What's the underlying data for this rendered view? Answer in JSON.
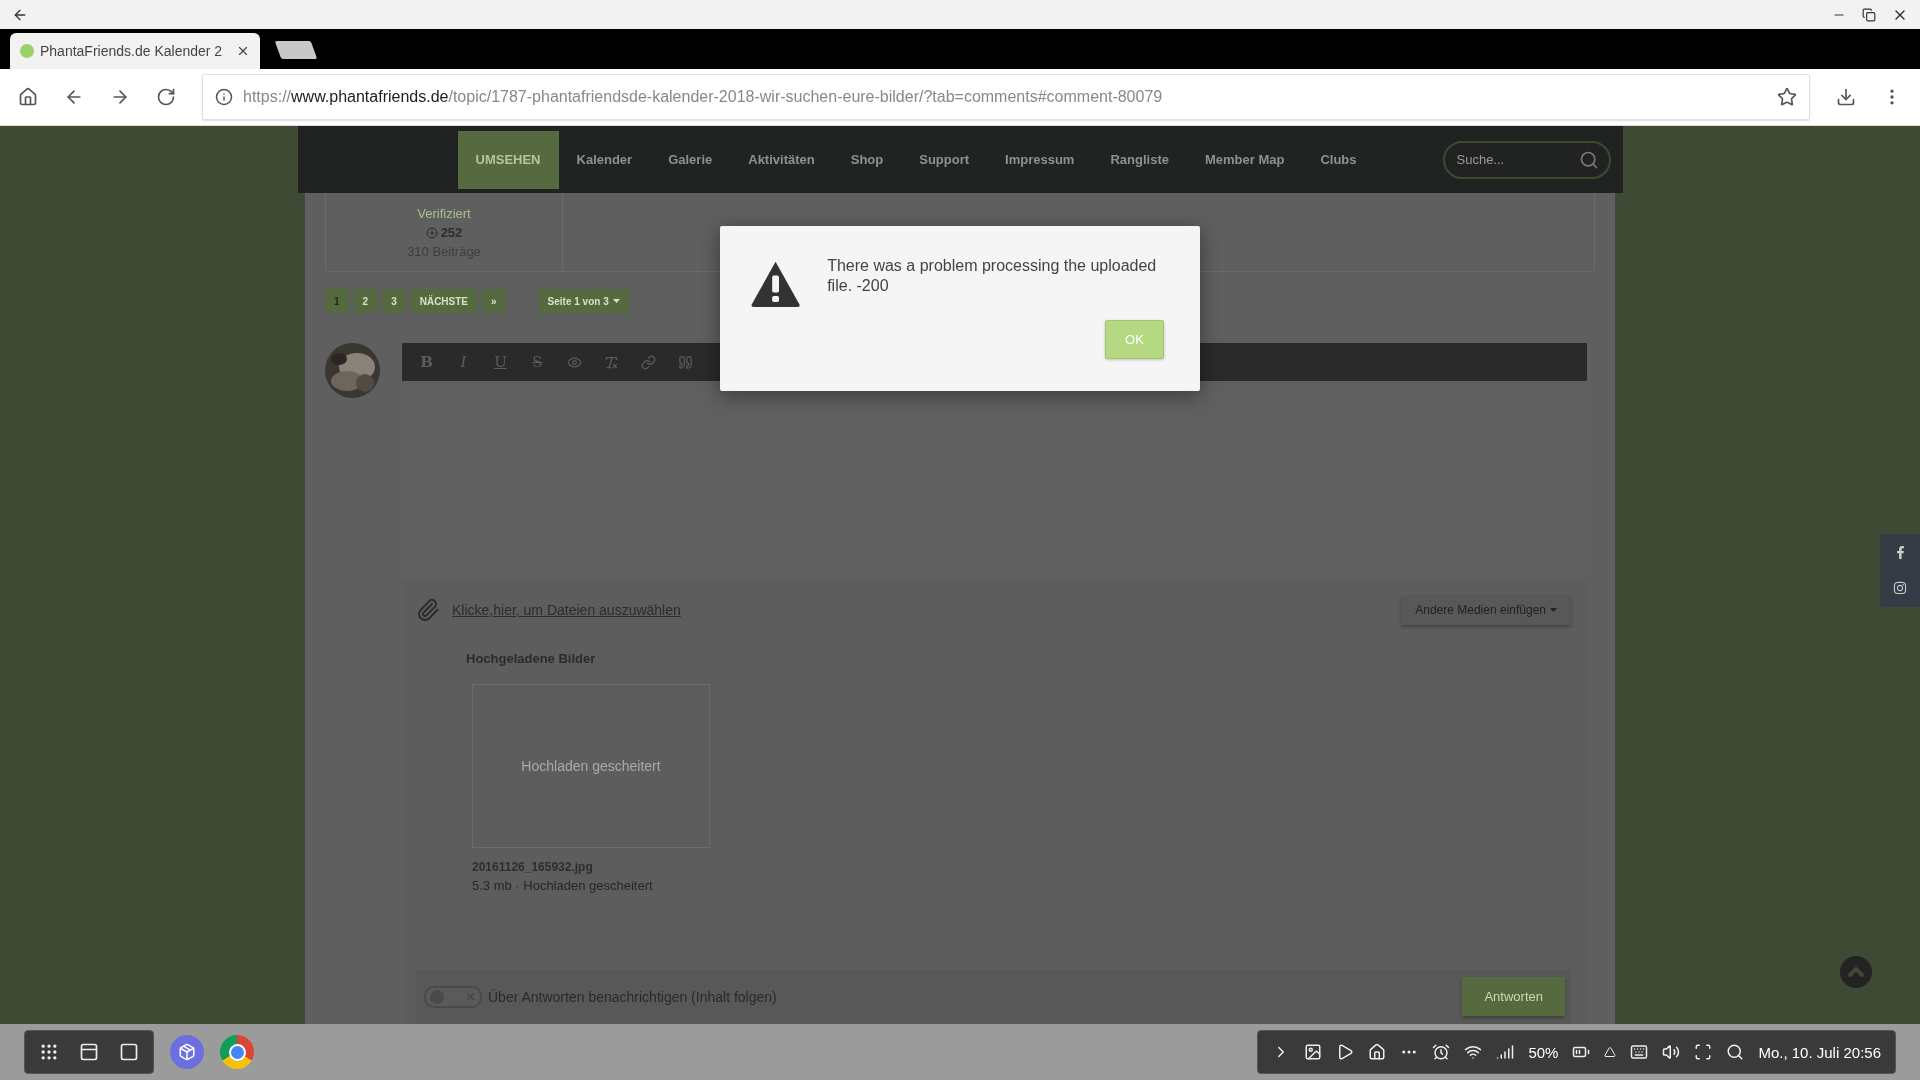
{
  "browser": {
    "tab": {
      "title": "PhantaFriends.de Kalender 2"
    },
    "url": {
      "scheme": "https://",
      "host": "www.phantafriends.de",
      "path": "/topic/1787-phantafriendsde-kalender-2018-wir-suchen-eure-bilder/?tab=comments#comment-80079"
    }
  },
  "nav": {
    "items": [
      {
        "label": "UMSEHEN",
        "selected": true
      },
      {
        "label": "Kalender",
        "selected": false
      },
      {
        "label": "Galerie",
        "selected": false
      },
      {
        "label": "Aktivitäten",
        "selected": false
      },
      {
        "label": "Shop",
        "selected": false
      },
      {
        "label": "Support",
        "selected": false
      },
      {
        "label": "Impressum",
        "selected": false
      },
      {
        "label": "Rangliste",
        "selected": false
      },
      {
        "label": "Member Map",
        "selected": false
      },
      {
        "label": "Clubs",
        "selected": false
      }
    ],
    "search": {
      "placeholder": "Suche..."
    }
  },
  "profile": {
    "status": "Verifiziert",
    "reputation": "252",
    "posts": "310 Beiträge"
  },
  "pagination": {
    "pages": [
      {
        "label": "1",
        "selected": true
      },
      {
        "label": "2",
        "selected": false
      },
      {
        "label": "3",
        "selected": false
      },
      {
        "label": "NÄCHSTE",
        "selected": false
      },
      {
        "label": "»",
        "selected": false
      }
    ],
    "page_select": "Seite 1 von 3"
  },
  "editor": {
    "toolbar": [
      {
        "kind": "bold",
        "label": "B"
      },
      {
        "kind": "italic",
        "label": "I"
      },
      {
        "kind": "underline",
        "label": "U"
      },
      {
        "kind": "strike",
        "label": "S"
      },
      {
        "kind": "preview"
      },
      {
        "kind": "clear"
      },
      {
        "kind": "link"
      },
      {
        "kind": "quote"
      }
    ],
    "attach_link": "Klicke,hier, um Dateien auszuwählen",
    "media_button": "Andere Medien einfügen",
    "uploaded_title": "Hochgeladene Bilder",
    "files": [
      {
        "thumb_text": "Hochladen gescheitert",
        "name": "20161126_165932.jpg",
        "meta": "5.3 mb · Hochladen gescheitert"
      }
    ],
    "notify": {
      "on": false,
      "label": "Über Antworten benachrichtigen (Inhalt folgen)"
    },
    "submit": "Antworten"
  },
  "dialog": {
    "message": "There was a problem processing the uploaded file. -200",
    "ok": "OK"
  },
  "taskbar": {
    "status": "50%",
    "clock": "Mo., 10. Juli 20:56"
  }
}
